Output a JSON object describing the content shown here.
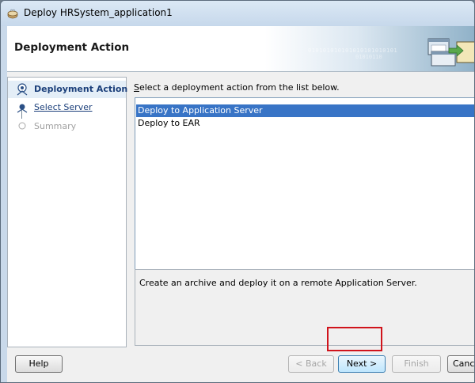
{
  "window": {
    "title": "Deploy HRSystem_application1"
  },
  "header": {
    "title": "Deployment Action",
    "binary_line1": "010101010101010101010101",
    "binary_line2": "01010110"
  },
  "nav": {
    "items": [
      {
        "label": "Deployment Action",
        "state": "active"
      },
      {
        "label": "Select Server",
        "state": "link"
      },
      {
        "label": "Summary",
        "state": "disabled"
      }
    ]
  },
  "main": {
    "instruction_prefix": "S",
    "instruction_rest": "elect a deployment action from the list below.",
    "actions": [
      {
        "label": "Deploy to Application Server",
        "selected": true
      },
      {
        "label": "Deploy to EAR",
        "selected": false
      }
    ],
    "description": "Create an archive and deploy it on a remote Application Server."
  },
  "buttons": {
    "help": "Help",
    "back": "< Back",
    "next": "Next >",
    "finish": "Finish",
    "cancel": "Cance"
  },
  "colors": {
    "selection": "#3874c6",
    "highlight_box": "#d0141c",
    "link": "#1b3f7a"
  }
}
